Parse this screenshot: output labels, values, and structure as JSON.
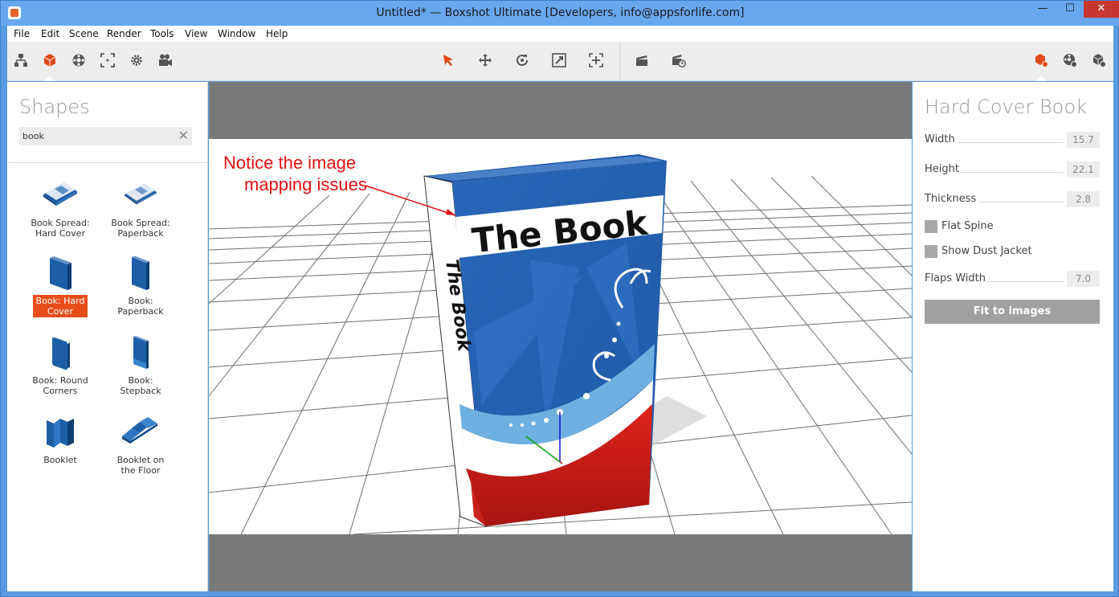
{
  "window": {
    "title": "Untitled* — Boxshot Ultimate [Developers, info@appsforlife.com]",
    "minimize": "—",
    "maximize": "☐",
    "close": "✕"
  },
  "menu": [
    "File",
    "Edit",
    "Scene",
    "Render",
    "Tools",
    "View",
    "Window",
    "Help"
  ],
  "toolbar": {
    "left_icons": [
      "hierarchy-icon",
      "shapes-icon",
      "materials-icon",
      "focus-icon",
      "settings-icon",
      "camera-icon"
    ],
    "center_icons": [
      "select-icon",
      "move-icon",
      "rotate-icon",
      "scale-icon",
      "snap-icon"
    ],
    "render_icons": [
      "clapper-icon",
      "clapper-timer-icon"
    ],
    "right_icons": [
      "add-shape-icon",
      "add-material-icon",
      "add-object-icon"
    ]
  },
  "shapes_panel": {
    "title": "Shapes",
    "search_value": "book",
    "items": [
      {
        "label1": "Book Spread:",
        "label2": "Hard Cover"
      },
      {
        "label1": "Book Spread:",
        "label2": "Paperback"
      },
      {
        "label1": "Book: Hard",
        "label2": "Cover"
      },
      {
        "label1": "Book:",
        "label2": "Paperback"
      },
      {
        "label1": "Book: Round",
        "label2": "Corners"
      },
      {
        "label1": "Book:",
        "label2": "Stepback"
      },
      {
        "label1": "Booklet",
        "label2": ""
      },
      {
        "label1": "Booklet on",
        "label2": "the Floor"
      }
    ]
  },
  "viewport": {
    "annotation_line1": "Notice the image",
    "annotation_line2": "mapping issues",
    "book_cover_title": "The Book",
    "book_spine_title": "The Book"
  },
  "properties": {
    "title": "Hard Cover Book",
    "width_label": "Width",
    "width_value": "15.7",
    "height_label": "Height",
    "height_value": "22.1",
    "thickness_label": "Thickness",
    "thickness_value": "2.8",
    "flat_spine_label": "Flat Spine",
    "dust_jacket_label": "Show Dust Jacket",
    "flaps_width_label": "Flaps Width",
    "flaps_width_value": "7.0",
    "fit_button": "Fit to images"
  },
  "colors": {
    "accent": "#e84e1b",
    "annotation": "#e01010",
    "titlebar": "#68a7ee"
  }
}
